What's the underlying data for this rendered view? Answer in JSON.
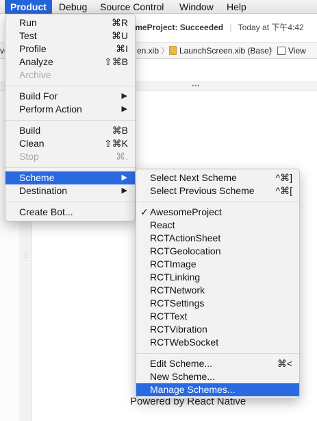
{
  "menubar": {
    "items": [
      {
        "label": "Product"
      },
      {
        "label": "Debug"
      },
      {
        "label": "Source Control"
      },
      {
        "label": "Window"
      },
      {
        "label": "Help"
      }
    ]
  },
  "background": {
    "status_project": "omeProject:",
    "status_result": "Succeeded",
    "status_time": "Today at 下午4:42",
    "jumpbar": {
      "item_1": "ve",
      "item_2": "en.xib",
      "item_3": "LaunchScreen.xib (Base)",
      "item_4": "View"
    },
    "footer_text": "Powered by React Native"
  },
  "product_menu": {
    "items": [
      {
        "label": "Run",
        "shortcut": "⌘R"
      },
      {
        "label": "Test",
        "shortcut": "⌘U"
      },
      {
        "label": "Profile",
        "shortcut": "⌘I"
      },
      {
        "label": "Analyze",
        "shortcut": "⇧⌘B"
      },
      {
        "label": "Archive",
        "shortcut": ""
      },
      {
        "label": "Build For",
        "submenu": "▶"
      },
      {
        "label": "Perform Action",
        "submenu": "▶"
      },
      {
        "label": "Build",
        "shortcut": "⌘B"
      },
      {
        "label": "Clean",
        "shortcut": "⇧⌘K"
      },
      {
        "label": "Stop",
        "shortcut": "⌘."
      },
      {
        "label": "Scheme",
        "submenu": "▶"
      },
      {
        "label": "Destination",
        "submenu": "▶"
      },
      {
        "label": "Create Bot..."
      }
    ]
  },
  "scheme_menu": {
    "items": [
      {
        "label": "Select Next Scheme",
        "shortcut": "^⌘]"
      },
      {
        "label": "Select Previous Scheme",
        "shortcut": "^⌘["
      },
      {
        "label": "AwesomeProject",
        "check": "✓"
      },
      {
        "label": "React"
      },
      {
        "label": "RCTActionSheet"
      },
      {
        "label": "RCTGeolocation"
      },
      {
        "label": "RCTImage"
      },
      {
        "label": "RCTLinking"
      },
      {
        "label": "RCTNetwork"
      },
      {
        "label": "RCTSettings"
      },
      {
        "label": "RCTText"
      },
      {
        "label": "RCTVibration"
      },
      {
        "label": "RCTWebSocket"
      },
      {
        "label": "Edit Scheme...",
        "shortcut": "⌘<"
      },
      {
        "label": "New Scheme..."
      },
      {
        "label": "Manage Schemes..."
      }
    ]
  },
  "colors": {
    "menu_highlight": "#2a6ae0",
    "menubar_active": "#2466d9",
    "disabled_text": "#a8a8a8"
  }
}
